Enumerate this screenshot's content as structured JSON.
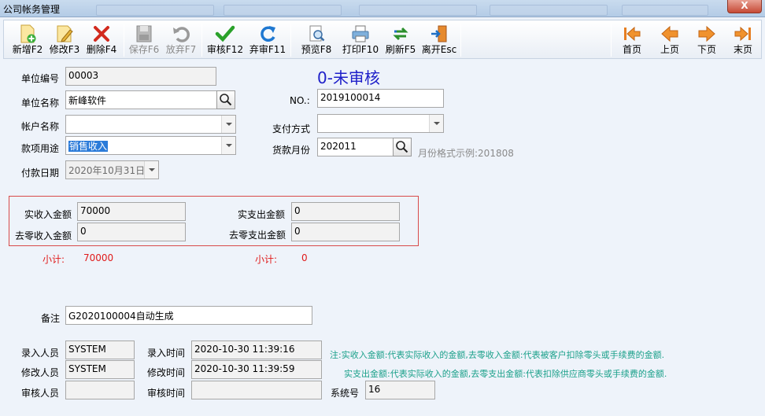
{
  "window": {
    "title": "公司帐务管理",
    "close_label": "X"
  },
  "toolbar": {
    "new": "新增F2",
    "edit": "修改F3",
    "delete": "删除F4",
    "save": "保存F6",
    "discard": "放弃F7",
    "approve": "审核F12",
    "unapprove": "弃审F11",
    "preview": "预览F8",
    "print": "打印F10",
    "refresh": "刷新F5",
    "exit": "离开Esc",
    "first": "首页",
    "prev": "上页",
    "next": "下页",
    "last": "末页"
  },
  "form": {
    "status": "0-未审核",
    "unit_no_label": "单位编号",
    "unit_no": "00003",
    "unit_name_label": "单位名称",
    "unit_name": "新峰软件",
    "no_label": "NO.:",
    "no": "2019100014",
    "account_label": "帐户名称",
    "account": "",
    "payment_label": "支付方式",
    "payment": "",
    "purpose_label": "款项用途",
    "purpose": "销售收入",
    "month_label": "货款月份",
    "month": "202011",
    "month_hint": "月份格式示例:201808",
    "date_label": "付款日期",
    "date": "2020年10月31日"
  },
  "amounts": {
    "income_label": "实收入金额",
    "income": "70000",
    "income_round_label": "去零收入金额",
    "income_round": "0",
    "expense_label": "实支出金额",
    "expense": "0",
    "expense_round_label": "去零支出金额",
    "expense_round": "0",
    "subtotal_label_1": "小计:",
    "subtotal_1": "70000",
    "subtotal_label_2": "小计:",
    "subtotal_2": "0"
  },
  "remark": {
    "label": "备注",
    "value": "G2020100004自动生成"
  },
  "audit": {
    "entry_user_label": "录入人员",
    "entry_user": "SYSTEM",
    "entry_time_label": "录入时间",
    "entry_time": "2020-10-30 11:39:16",
    "modify_user_label": "修改人员",
    "modify_user": "SYSTEM",
    "modify_time_label": "修改时间",
    "modify_time": "2020-10-30 11:39:59",
    "approve_user_label": "审核人员",
    "approve_user": "",
    "approve_time_label": "审核时间",
    "approve_time": "",
    "sys_no_label": "系统号",
    "sys_no": "16"
  },
  "notes": {
    "line1": "注:实收入金额:代表实际收入的金额,去零收入金额:代表被客户扣除零头或手续费的金额.",
    "line2": "实支出金额:代表实际收入的金额,去零支出金额:代表扣除供应商零头或手续费的金额."
  },
  "colors": {
    "status_blue": "#1f20c9",
    "subtotal_red": "#e01a1a",
    "note_teal": "#1aa08a",
    "selection_blue": "#2b7bd9"
  }
}
